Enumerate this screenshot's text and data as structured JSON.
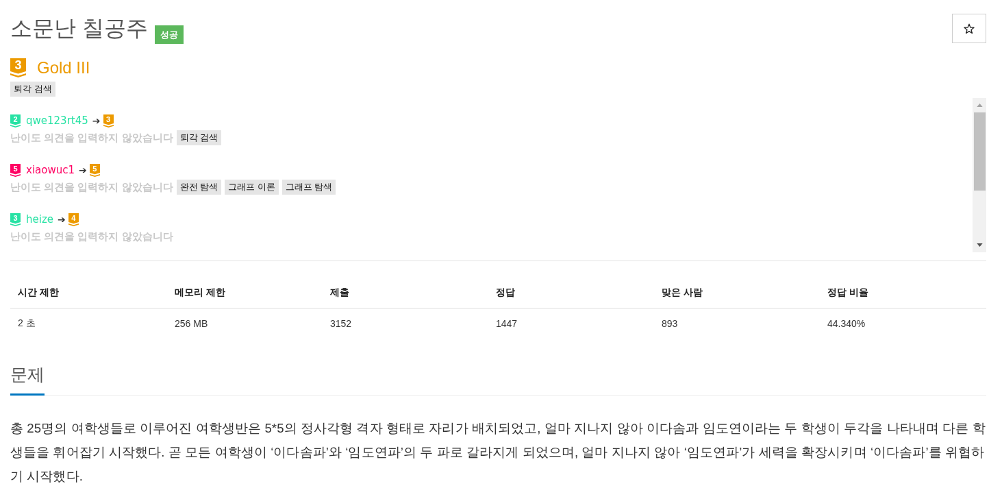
{
  "problem": {
    "title": "소문난 칠공주",
    "result_badge": "성공"
  },
  "tier": {
    "number": "3",
    "name": "Gold III",
    "color": "#ec9a00"
  },
  "tags": [
    "퇴각 검색"
  ],
  "opinions": [
    {
      "user": {
        "tier_number": "2",
        "name": "qwe123rt45",
        "color": "#27e2a4"
      },
      "arrow": "➔",
      "opinion_tier": {
        "number": "3",
        "color": "#ec9a00"
      },
      "comment": "난이도 의견을 입력하지 않았습니다",
      "tags": [
        "퇴각 검색"
      ]
    },
    {
      "user": {
        "tier_number": "5",
        "name": "xiaowuc1",
        "color": "#ff0062"
      },
      "arrow": "➔",
      "opinion_tier": {
        "number": "5",
        "color": "#ec9a00"
      },
      "comment": "난이도 의견을 입력하지 않았습니다",
      "tags": [
        "완전 탐색",
        "그래프 이론",
        "그래프 탐색"
      ]
    },
    {
      "user": {
        "tier_number": "3",
        "name": "heize",
        "color": "#27e2a4"
      },
      "arrow": "➔",
      "opinion_tier": {
        "number": "4",
        "color": "#ec9a00"
      },
      "comment": "난이도 의견을 입력하지 않았습니다"
    }
  ],
  "limits_table": {
    "columns": [
      "시간 제한",
      "메모리 제한",
      "제출",
      "정답",
      "맞은 사람",
      "정답 비율"
    ],
    "rows": [
      [
        "2 초",
        "256 MB",
        "3152",
        "1447",
        "893",
        "44.340%"
      ]
    ]
  },
  "section": {
    "heading": "문제",
    "paragraph": "총 25명의 여학생들로 이루어진 여학생반은 5*5의 정사각형 격자 형태로 자리가 배치되었고, 얼마 지나지 않아 이다솜과 임도연이라는 두 학생이 두각을 나타내며 다른 학생들을 휘어잡기 시작했다. 곧 모든 여학생이 ‘이다솜파’와 ‘임도연파’의 두 파로 갈라지게 되었으며, 얼마 지나지 않아 ‘임도연파’가 세력을 확장시키며 ‘이다솜파’를 위협하기 시작했다."
  }
}
